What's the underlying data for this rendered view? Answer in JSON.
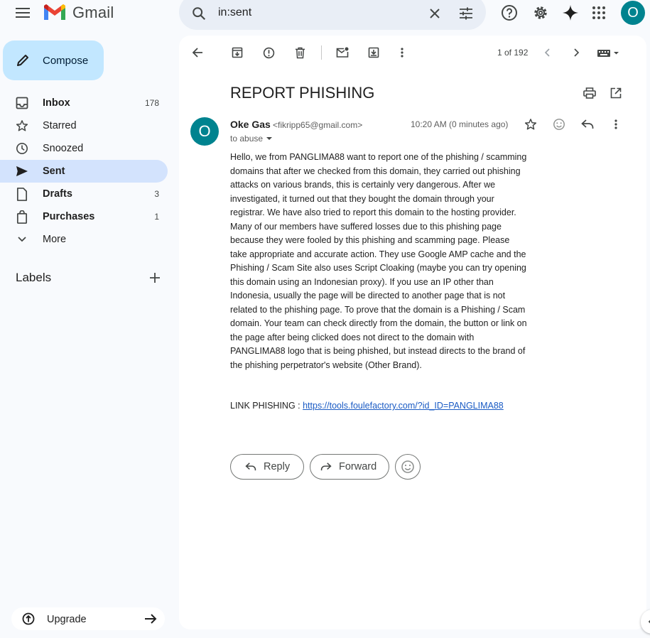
{
  "app": {
    "name": "Gmail",
    "user_initial": "O"
  },
  "search": {
    "query": "in:sent"
  },
  "compose": {
    "label": "Compose"
  },
  "sidebar": {
    "items": [
      {
        "label": "Inbox",
        "count": "178",
        "icon": "inbox-icon"
      },
      {
        "label": "Starred",
        "count": "",
        "icon": "star-icon"
      },
      {
        "label": "Snoozed",
        "count": "",
        "icon": "clock-icon"
      },
      {
        "label": "Sent",
        "count": "",
        "icon": "send-icon"
      },
      {
        "label": "Drafts",
        "count": "3",
        "icon": "draft-icon"
      },
      {
        "label": "Purchases",
        "count": "1",
        "icon": "shopping-bag-icon"
      },
      {
        "label": "More",
        "count": "",
        "icon": "chevron-down-icon"
      }
    ],
    "labels_title": "Labels",
    "upgrade": "Upgrade"
  },
  "toolbar": {
    "pager": "1 of 192"
  },
  "email": {
    "subject": "REPORT PHISHING",
    "sender_initial": "O",
    "sender_name": "Oke Gas",
    "sender_email": "<fikripp65@gmail.com>",
    "to": "to abuse",
    "time": "10:20 AM (0 minutes ago)",
    "body": "Hello, we from PANGLIMA88 want to report one of the phishing / scamming domains that after we checked from this domain, they carried out phishing attacks on various brands, this is certainly very dangerous. After we investigated, it turned out that they bought the domain through your registrar. We have also tried to report this domain to the hosting provider. Many of our members have suffered losses due to this phishing page because they were fooled by this phishing and scamming page. Please take appropriate and accurate action. They use Google AMP cache and the Phishing / Scam Site also uses Script Cloaking (maybe you can try opening this domain using an Indonesian proxy). If you use an IP other than Indonesia, usually the page will be directed to another page that is not related to the phishing page. To prove that the domain is a Phishing / Scam domain. Your team can check directly from the domain, the button or link on the page after being clicked does not direct to the domain with PANGLIMA88 logo that is being phished, but instead directs to the brand of the phishing perpetrator's website (Other Brand).",
    "link_prefix": "LINK PHISHING : ",
    "link_url": "https://tools.foulefactory.com/?id_ID=PANGLIMA88"
  },
  "actions": {
    "reply": "Reply",
    "forward": "Forward"
  },
  "colors": {
    "accent": "#0b57d0",
    "compose_bg": "#c2e7ff",
    "active_nav": "#d3e3fd",
    "avatar": "#00838f"
  }
}
